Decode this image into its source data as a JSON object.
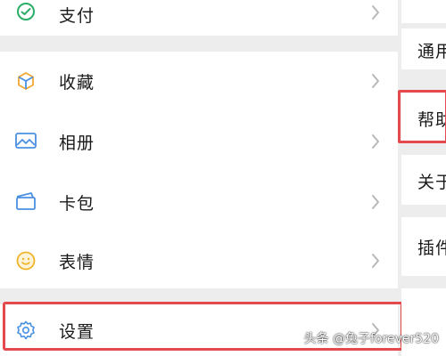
{
  "menu": {
    "items": [
      {
        "label": "支付",
        "icon": "pay-icon"
      },
      {
        "label": "收藏",
        "icon": "favorites-icon"
      },
      {
        "label": "相册",
        "icon": "album-icon"
      },
      {
        "label": "卡包",
        "icon": "card-wallet-icon"
      },
      {
        "label": "表情",
        "icon": "sticker-icon"
      },
      {
        "label": "设置",
        "icon": "settings-icon"
      }
    ]
  },
  "settings_panel": {
    "items": [
      {
        "label": "通用"
      },
      {
        "label": "帮助"
      },
      {
        "label": "关于"
      },
      {
        "label": "插件"
      }
    ]
  },
  "watermark": "头条 @兔子forever520",
  "colors": {
    "accent_green": "#2aae67",
    "highlight_red": "#e5484d",
    "row_bg": "#ffffff",
    "separator_bg": "#ededed"
  }
}
